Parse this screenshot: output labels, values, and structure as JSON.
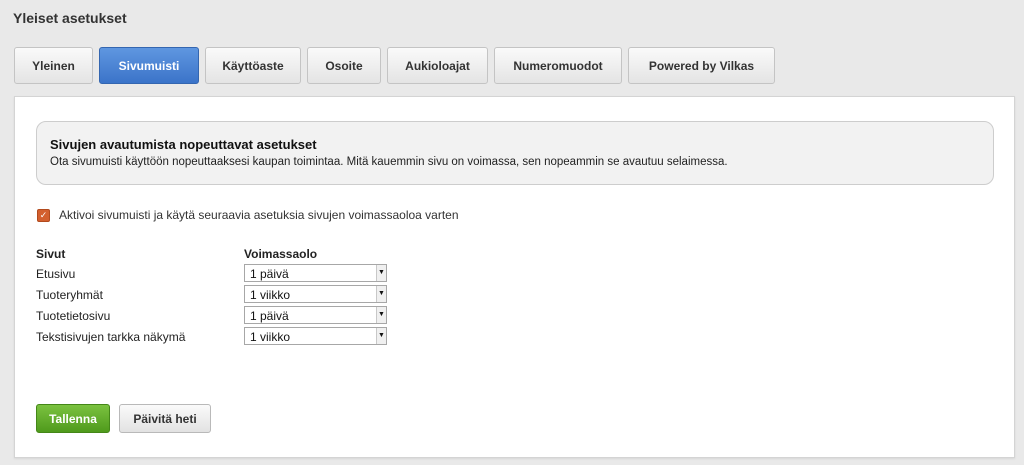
{
  "page": {
    "title": "Yleiset asetukset"
  },
  "tabs": [
    {
      "label": "Yleinen",
      "active": false
    },
    {
      "label": "Sivumuisti",
      "active": true
    },
    {
      "label": "Käyttöaste",
      "active": false
    },
    {
      "label": "Osoite",
      "active": false
    },
    {
      "label": "Aukioloajat",
      "active": false
    },
    {
      "label": "Numeromuodot",
      "active": false
    },
    {
      "label": "Powered by Vilkas",
      "active": false
    }
  ],
  "info": {
    "title": "Sivujen avautumista nopeuttavat asetukset",
    "text": "Ota sivumuisti käyttöön nopeuttaaksesi kaupan toimintaa. Mitä kauemmin sivu on voimassa, sen nopeammin se avautuu selaimessa."
  },
  "enable": {
    "checked": true,
    "label": "Aktivoi sivumuisti ja käytä seuraavia asetuksia sivujen voimassaoloa varten"
  },
  "settings": {
    "col_pages": "Sivut",
    "col_validity": "Voimassaolo",
    "rows": [
      {
        "label": "Etusivu",
        "value": "1 päivä"
      },
      {
        "label": "Tuoteryhmät",
        "value": "1 viikko"
      },
      {
        "label": "Tuotetietosivu",
        "value": "1 päivä"
      },
      {
        "label": "Tekstisivujen tarkka näkymä",
        "value": "1 viikko"
      }
    ]
  },
  "buttons": {
    "save": "Tallenna",
    "refresh": "Päivitä heti"
  },
  "colors": {
    "accent_blue": "#4a84d4",
    "save_green": "#5fab2a",
    "checkbox_orange": "#d35f2e"
  }
}
